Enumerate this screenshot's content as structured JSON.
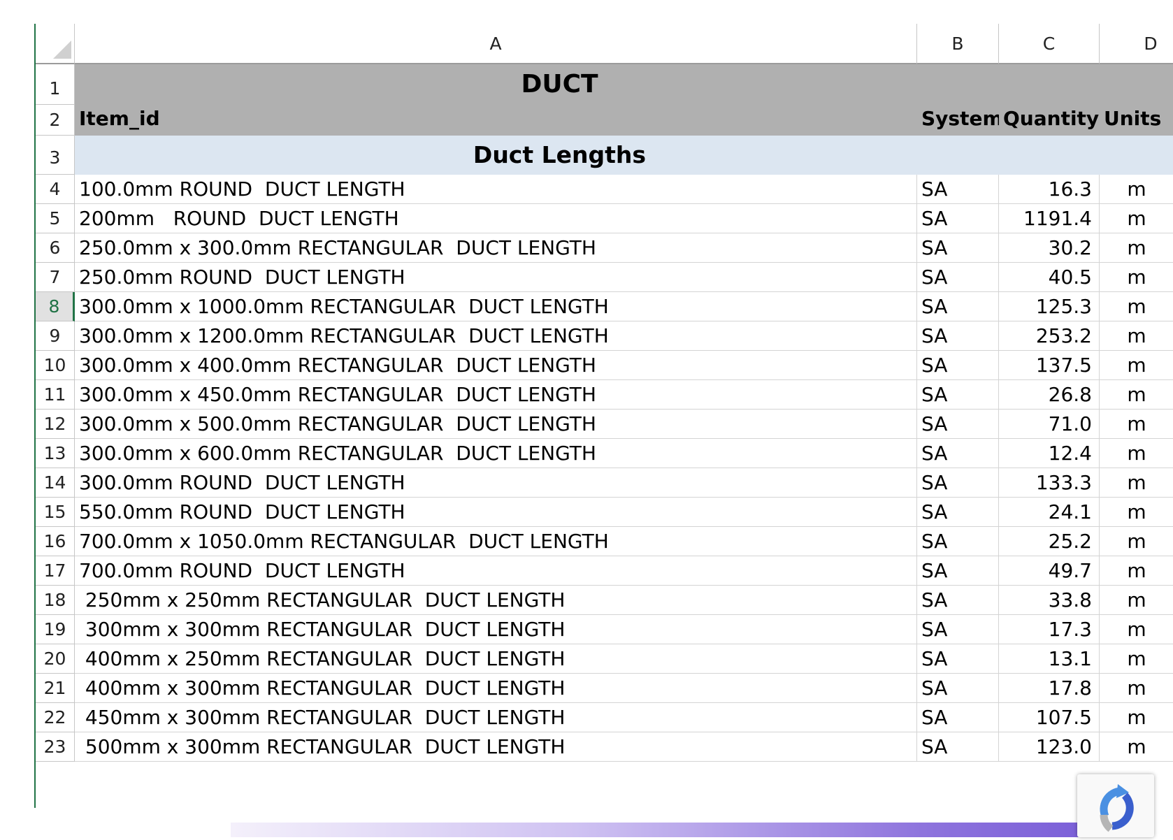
{
  "columns": {
    "A": "A",
    "B": "B",
    "C": "C",
    "D": "D"
  },
  "sheet": {
    "title": "DUCT",
    "headers": {
      "item": "Item_id",
      "system": "System",
      "quantity": "Quantity",
      "units": "Units"
    },
    "section": "Duct Lengths",
    "row_numbers": [
      "1",
      "2",
      "3",
      "4",
      "5",
      "6",
      "7",
      "8",
      "9",
      "10",
      "11",
      "12",
      "13",
      "14",
      "15",
      "16",
      "17",
      "18",
      "19",
      "20",
      "21",
      "22",
      "23"
    ],
    "active_row": "8",
    "rows": [
      {
        "num": "4",
        "item": "100.0mm ROUND  DUCT LENGTH",
        "system": "SA",
        "quantity": "16.3",
        "units": "m"
      },
      {
        "num": "5",
        "item": "200mm   ROUND  DUCT LENGTH",
        "system": "SA",
        "quantity": "1191.4",
        "units": "m"
      },
      {
        "num": "6",
        "item": "250.0mm x 300.0mm RECTANGULAR  DUCT LENGTH",
        "system": "SA",
        "quantity": "30.2",
        "units": "m"
      },
      {
        "num": "7",
        "item": "250.0mm ROUND  DUCT LENGTH",
        "system": "SA",
        "quantity": "40.5",
        "units": "m"
      },
      {
        "num": "8",
        "item": "300.0mm x 1000.0mm RECTANGULAR  DUCT LENGTH",
        "system": "SA",
        "quantity": "125.3",
        "units": "m"
      },
      {
        "num": "9",
        "item": "300.0mm x 1200.0mm RECTANGULAR  DUCT LENGTH",
        "system": "SA",
        "quantity": "253.2",
        "units": "m"
      },
      {
        "num": "10",
        "item": "300.0mm x 400.0mm RECTANGULAR  DUCT LENGTH",
        "system": "SA",
        "quantity": "137.5",
        "units": "m"
      },
      {
        "num": "11",
        "item": "300.0mm x 450.0mm RECTANGULAR  DUCT LENGTH",
        "system": "SA",
        "quantity": "26.8",
        "units": "m"
      },
      {
        "num": "12",
        "item": "300.0mm x 500.0mm RECTANGULAR  DUCT LENGTH",
        "system": "SA",
        "quantity": "71.0",
        "units": "m"
      },
      {
        "num": "13",
        "item": "300.0mm x 600.0mm RECTANGULAR  DUCT LENGTH",
        "system": "SA",
        "quantity": "12.4",
        "units": "m"
      },
      {
        "num": "14",
        "item": "300.0mm ROUND  DUCT LENGTH",
        "system": "SA",
        "quantity": "133.3",
        "units": "m"
      },
      {
        "num": "15",
        "item": "550.0mm ROUND  DUCT LENGTH",
        "system": "SA",
        "quantity": "24.1",
        "units": "m"
      },
      {
        "num": "16",
        "item": "700.0mm x 1050.0mm RECTANGULAR  DUCT LENGTH",
        "system": "SA",
        "quantity": "25.2",
        "units": "m"
      },
      {
        "num": "17",
        "item": "700.0mm ROUND  DUCT LENGTH",
        "system": "SA",
        "quantity": "49.7",
        "units": "m"
      },
      {
        "num": "18",
        "item": " 250mm x 250mm RECTANGULAR  DUCT LENGTH",
        "system": "SA",
        "quantity": "33.8",
        "units": "m"
      },
      {
        "num": "19",
        "item": " 300mm x 300mm RECTANGULAR  DUCT LENGTH",
        "system": "SA",
        "quantity": "17.3",
        "units": "m"
      },
      {
        "num": "20",
        "item": " 400mm x 250mm RECTANGULAR  DUCT LENGTH",
        "system": "SA",
        "quantity": "13.1",
        "units": "m"
      },
      {
        "num": "21",
        "item": " 400mm x 300mm RECTANGULAR  DUCT LENGTH",
        "system": "SA",
        "quantity": "17.8",
        "units": "m"
      },
      {
        "num": "22",
        "item": " 450mm x 300mm RECTANGULAR  DUCT LENGTH",
        "system": "SA",
        "quantity": "107.5",
        "units": "m"
      },
      {
        "num": "23",
        "item": " 500mm x 300mm RECTANGULAR  DUCT LENGTH",
        "system": "SA",
        "quantity": "123.0",
        "units": "m"
      }
    ]
  },
  "colors": {
    "title_fill": "#b0b0b0",
    "section_fill": "#dce6f1",
    "selection_accent": "#217346"
  },
  "icons": {
    "select_all": "select-all-triangle",
    "recaptcha": "recaptcha-icon"
  }
}
